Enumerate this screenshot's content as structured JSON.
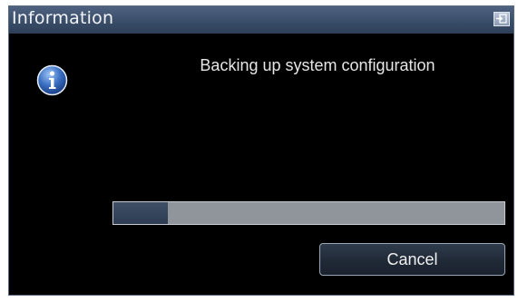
{
  "window": {
    "title": "Information",
    "title_button_icon": "restore-icon"
  },
  "message": {
    "icon": "info-icon",
    "text": "Backing up system configuration"
  },
  "progress": {
    "fraction": 0.14
  },
  "buttons": {
    "cancel_label": "Cancel"
  },
  "colors": {
    "titlebar": "#3a4d69",
    "background": "#000000",
    "progress_track": "#8f959b",
    "progress_fill": "#34445a",
    "info_icon": "#2d5fb0"
  }
}
